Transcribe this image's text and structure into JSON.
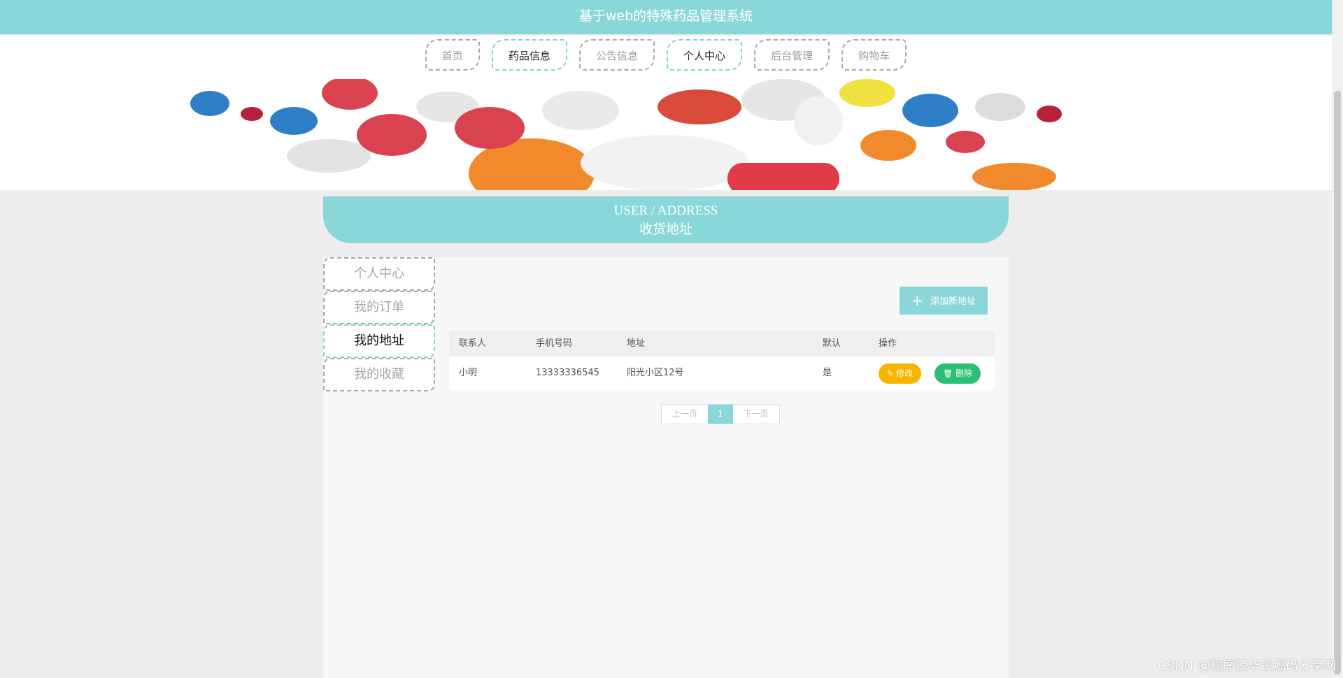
{
  "header": {
    "title": "基于web的特殊药品管理系统"
  },
  "nav": {
    "items": [
      {
        "label": "首页"
      },
      {
        "label": "药品信息"
      },
      {
        "label": "公告信息"
      },
      {
        "label": "个人中心"
      },
      {
        "label": "后台管理"
      },
      {
        "label": "购物车"
      }
    ]
  },
  "section": {
    "en_title": "USER / ADDRESS",
    "cn_title": "收货地址"
  },
  "sidebar": {
    "items": [
      {
        "label": "个人中心"
      },
      {
        "label": "我的订单"
      },
      {
        "label": "我的地址"
      },
      {
        "label": "我的收藏"
      }
    ]
  },
  "actions": {
    "add_label": "添加新地址"
  },
  "table": {
    "headers": [
      "联系人",
      "手机号码",
      "地址",
      "默认",
      "操作"
    ],
    "rows": [
      {
        "name": "小明",
        "phone": "13333336545",
        "address": "阳光小区12号",
        "default": "是",
        "edit": "修改",
        "delete": "删除"
      }
    ]
  },
  "pager": {
    "prev": "上一页",
    "current": "1",
    "next": "下一页"
  },
  "watermark": "CSDN @程序猿毕设源码分享网",
  "colors": {
    "accent": "#8ad7d9",
    "edit": "#f7b500",
    "delete": "#2bbe74"
  }
}
